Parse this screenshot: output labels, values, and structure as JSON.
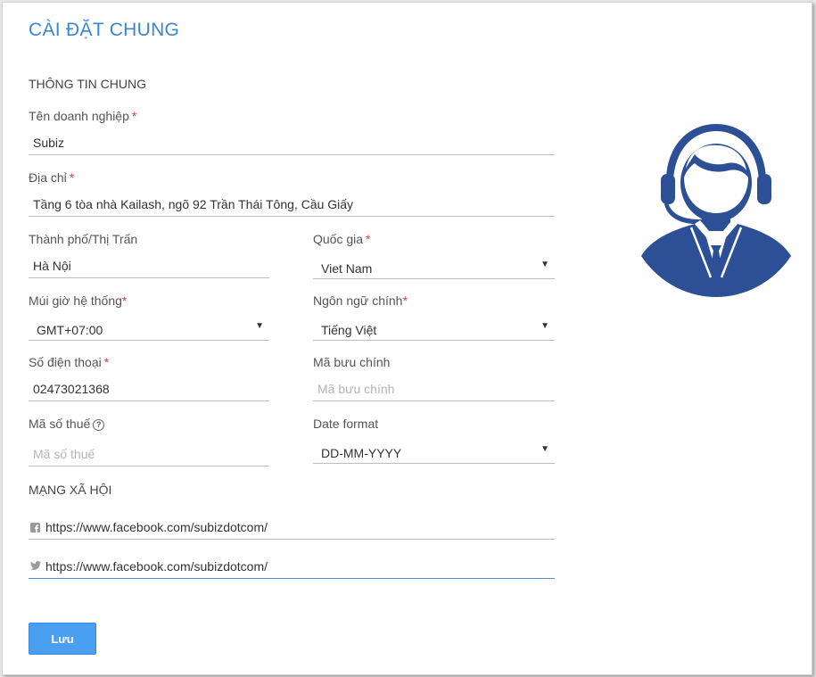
{
  "page": {
    "title": "CÀI ĐẶT CHUNG"
  },
  "general": {
    "heading": "THÔNG TIN CHUNG",
    "required_mark": "*",
    "business_name": {
      "label": "Tên doanh nghiệp",
      "value": "Subiz"
    },
    "address": {
      "label": "Địa chỉ",
      "value": "Tầng 6 tòa nhà Kailash, ngõ 92 Trần Thái Tông, Cầu Giấy"
    },
    "city": {
      "label": "Thành phố/Thị Trấn",
      "value": "Hà Nội"
    },
    "country": {
      "label": "Quốc gia",
      "value": "Viet Nam"
    },
    "timezone": {
      "label": "Múi giờ hệ thống",
      "value": "GMT+07:00"
    },
    "language": {
      "label": "Ngôn ngữ chính",
      "value": "Tiếng Việt"
    },
    "phone": {
      "label": "Số điện thoại",
      "value": "02473021368"
    },
    "postal_code": {
      "label": "Mã bưu chính",
      "placeholder": "Mã bưu chính"
    },
    "tax_code": {
      "label": "Mã số thuế",
      "placeholder": "Mã số thuế",
      "help_glyph": "?"
    },
    "date_format": {
      "label": "Date format",
      "value": "DD-MM-YYYY"
    },
    "caret": "▼"
  },
  "social": {
    "heading": "MẠNG XÃ HỘI",
    "facebook": {
      "icon": "facebook-icon",
      "value": "https://www.facebook.com/subizdotcom/"
    },
    "twitter": {
      "icon": "twitter-icon",
      "value": "https://www.facebook.com/subizdotcom/"
    }
  },
  "actions": {
    "save_label": "Lưu"
  },
  "colors": {
    "title": "#3b86d1",
    "button": "#4a9ff0",
    "avatar": "#2c4f96",
    "required": "#e0453a"
  }
}
